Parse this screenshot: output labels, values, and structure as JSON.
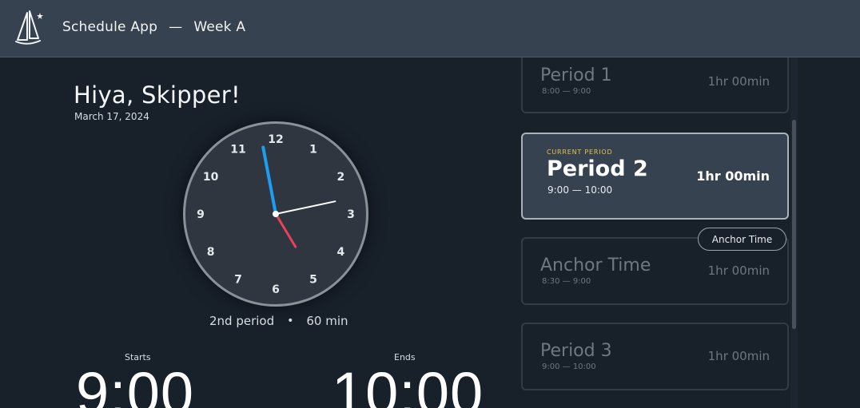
{
  "header": {
    "app_name": "Schedule App",
    "separator": "—",
    "week": "Week A",
    "logo_icon": "sailboat-icon"
  },
  "greeting": "Hiya, Skipper!",
  "date": "March 17, 2024",
  "clock": {
    "numbers": [
      "12",
      "1",
      "2",
      "3",
      "4",
      "5",
      "6",
      "7",
      "8",
      "9",
      "10",
      "11"
    ],
    "hour": 4,
    "minute": 58,
    "second": 13,
    "colors": {
      "minute_hand": "#1e9cf0",
      "hour_hand": "#e8415a",
      "second_hand": "#ffffff",
      "face": "#2f3640"
    }
  },
  "caption": {
    "period": "2nd period",
    "dot": "•",
    "length": "60 min"
  },
  "starts": {
    "label": "Starts",
    "time": "9:00"
  },
  "ends": {
    "label": "Ends",
    "time": "10:00"
  },
  "periods": [
    {
      "name": "Period 1",
      "range": "8:00  —  9:00",
      "duration": "1hr 00min"
    },
    {
      "current_label": "CURRENT PERIOD",
      "name": "Period 2",
      "range": "9:00  —  10:00",
      "duration": "1hr 00min"
    },
    {
      "name": "Anchor Time",
      "range": "8:30  —  9:00",
      "duration": "1hr 00min"
    },
    {
      "name": "Period 3",
      "range": "9:00  —  10:00",
      "duration": "1hr 00min"
    }
  ],
  "anchor_pill": "Anchor Time",
  "accent": "#e7c34d"
}
